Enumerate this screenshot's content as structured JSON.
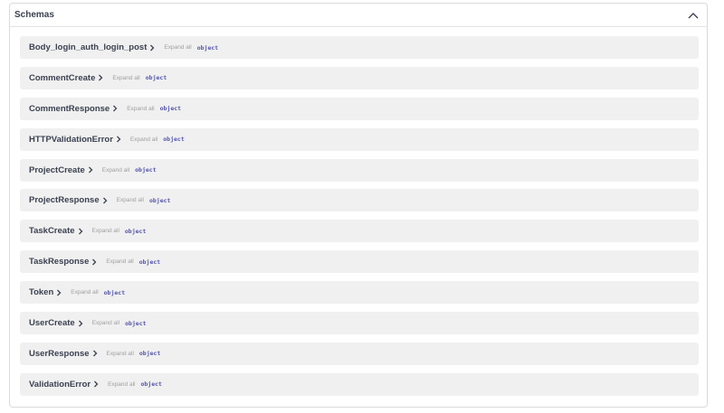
{
  "schemas_section": {
    "title": "Schemas",
    "toggle_icon": "chevron-up-icon",
    "models": [
      {
        "name": "Body_login_auth_login_post",
        "expand_label": "Expand all",
        "type": "object"
      },
      {
        "name": "CommentCreate",
        "expand_label": "Expand all",
        "type": "object"
      },
      {
        "name": "CommentResponse",
        "expand_label": "Expand all",
        "type": "object"
      },
      {
        "name": "HTTPValidationError",
        "expand_label": "Expand all",
        "type": "object"
      },
      {
        "name": "ProjectCreate",
        "expand_label": "Expand all",
        "type": "object"
      },
      {
        "name": "ProjectResponse",
        "expand_label": "Expand all",
        "type": "object"
      },
      {
        "name": "TaskCreate",
        "expand_label": "Expand all",
        "type": "object"
      },
      {
        "name": "TaskResponse",
        "expand_label": "Expand all",
        "type": "object"
      },
      {
        "name": "Token",
        "expand_label": "Expand all",
        "type": "object"
      },
      {
        "name": "UserCreate",
        "expand_label": "Expand all",
        "type": "object"
      },
      {
        "name": "UserResponse",
        "expand_label": "Expand all",
        "type": "object"
      },
      {
        "name": "ValidationError",
        "expand_label": "Expand all",
        "type": "object"
      }
    ]
  }
}
